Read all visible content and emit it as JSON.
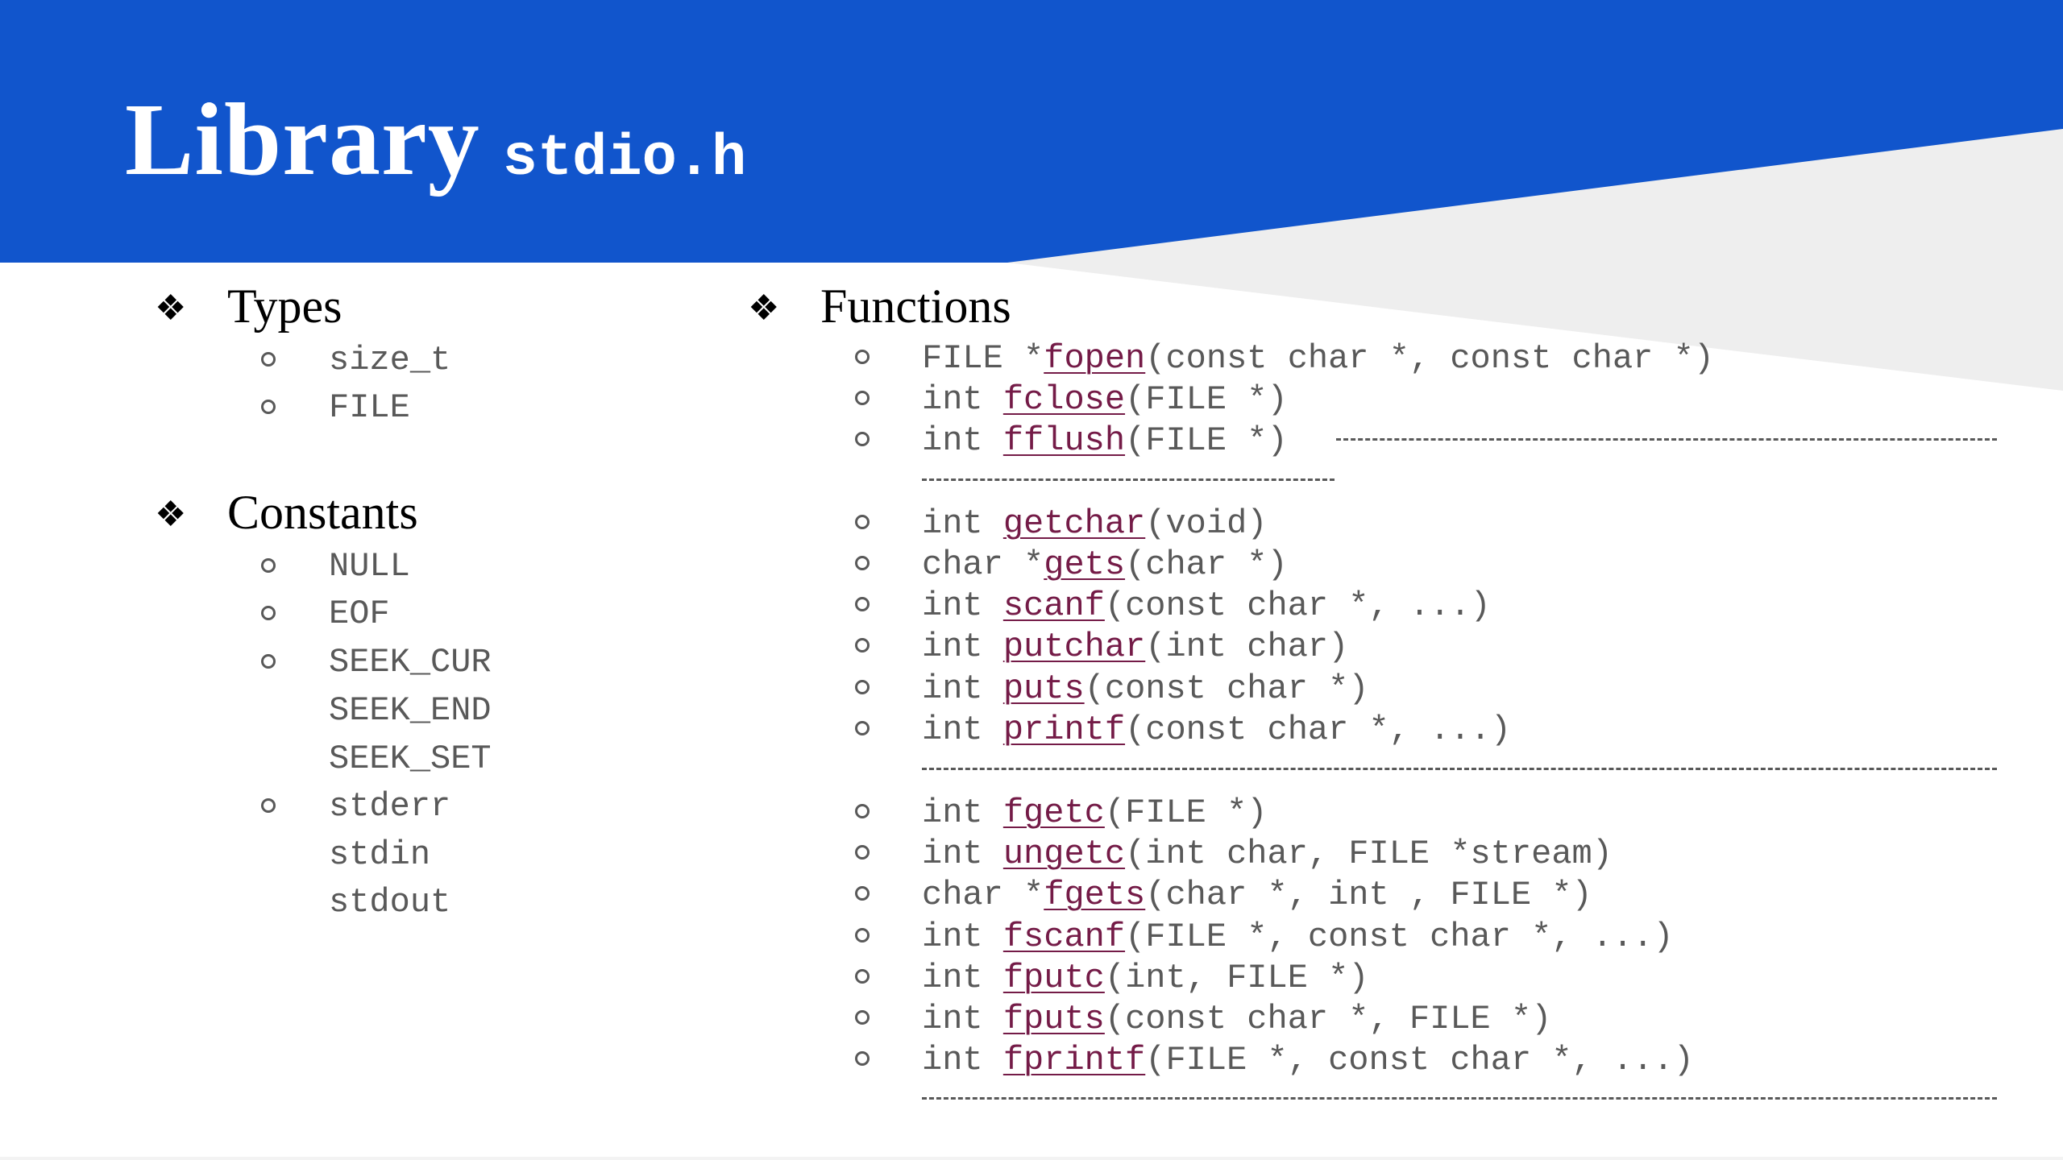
{
  "title": {
    "main": "Library",
    "sub": "stdio.h"
  },
  "types": {
    "heading": "Types",
    "bullet_icon": "diamond-bullet-icon",
    "items": [
      "size_t",
      "FILE"
    ]
  },
  "constants": {
    "heading": "Constants",
    "items": [
      "NULL",
      "EOF",
      "SEEK_CUR",
      "SEEK_END",
      "SEEK_SET",
      "stderr",
      "stdin",
      "stdout"
    ]
  },
  "functions": {
    "heading": "Functions",
    "items": [
      {
        "ret": "FILE *",
        "name": "fopen",
        "args": "(const char *, const char *)"
      },
      {
        "ret": "int ",
        "name": "fclose",
        "args": "(FILE *)"
      },
      {
        "ret": "int ",
        "name": "fflush",
        "args": "(FILE *)"
      },
      {
        "ret": "int ",
        "name": "getchar",
        "args": "(void)"
      },
      {
        "ret": "char *",
        "name": "gets",
        "args": "(char *)"
      },
      {
        "ret": "int ",
        "name": "scanf",
        "args": "(const char *, ...)"
      },
      {
        "ret": "int ",
        "name": "putchar",
        "args": "(int char)"
      },
      {
        "ret": "int ",
        "name": "puts",
        "args": "(const char *)"
      },
      {
        "ret": "int ",
        "name": "printf",
        "args": "(const char *, ...)"
      },
      {
        "ret": "int ",
        "name": "fgetc",
        "args": "(FILE *)"
      },
      {
        "ret": "int ",
        "name": "ungetc",
        "args": "(int char, FILE *stream)"
      },
      {
        "ret": "char *",
        "name": "fgets",
        "args": "(char *, int , FILE *)"
      },
      {
        "ret": "int ",
        "name": "fscanf",
        "args": "(FILE *, const char *, ...)"
      },
      {
        "ret": "int ",
        "name": "fputc",
        "args": "(int, FILE *)"
      },
      {
        "ret": "int ",
        "name": "fputs",
        "args": "(const char *, FILE *)"
      },
      {
        "ret": "int ",
        "name": "fprintf",
        "args": "(FILE *, const char *, ...)"
      }
    ]
  },
  "colors": {
    "header_bg": "#1155cc",
    "function_link": "#741b47",
    "body_text": "#595959"
  }
}
